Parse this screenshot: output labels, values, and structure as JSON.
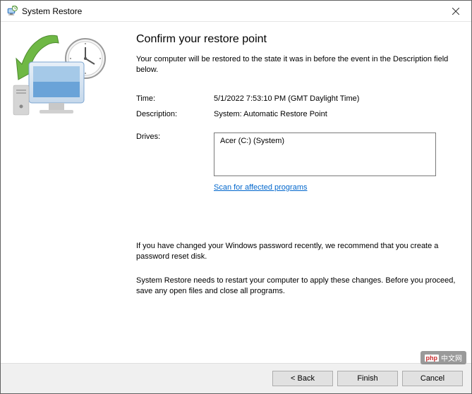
{
  "titlebar": {
    "title": "System Restore"
  },
  "heading": "Confirm your restore point",
  "subheading": "Your computer will be restored to the state it was in before the event in the Description field below.",
  "info": {
    "time_label": "Time:",
    "time_value": "5/1/2022 7:53:10 PM (GMT Daylight Time)",
    "description_label": "Description:",
    "description_value": "System: Automatic Restore Point",
    "drives_label": "Drives:",
    "drives_value": "Acer (C:) (System)"
  },
  "scan_link": "Scan for affected programs",
  "warning1": "If you have changed your Windows password recently, we recommend that you create a password reset disk.",
  "warning2": "System Restore needs to restart your computer to apply these changes. Before you proceed, save any open files and close all programs.",
  "buttons": {
    "back": "< Back",
    "finish": "Finish",
    "cancel": "Cancel"
  },
  "watermark": "中文网"
}
